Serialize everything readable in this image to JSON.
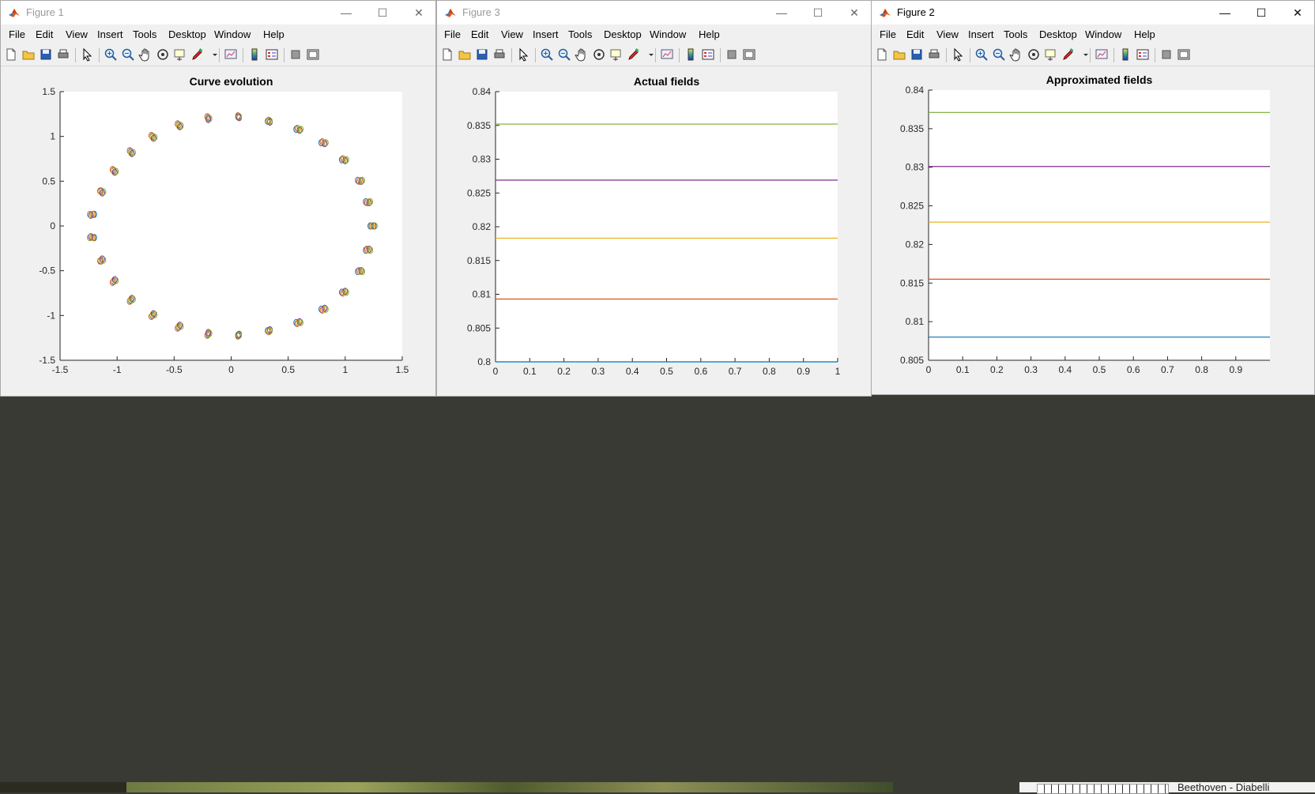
{
  "windows": [
    {
      "id": "fig1",
      "title": "Figure 1",
      "menus": [
        "File",
        "Edit",
        "View",
        "Insert",
        "Tools",
        "Desktop",
        "Window",
        "Help"
      ]
    },
    {
      "id": "fig3",
      "title": "Figure 3",
      "menus": [
        "File",
        "Edit",
        "View",
        "Insert",
        "Tools",
        "Desktop",
        "Window",
        "Help"
      ]
    },
    {
      "id": "fig2",
      "title": "Figure 2",
      "menus": [
        "File",
        "Edit",
        "View",
        "Insert",
        "Tools",
        "Desktop",
        "Window",
        "Help"
      ]
    }
  ],
  "window_buttons": {
    "minimize": "—",
    "maximize": "☐",
    "close": "✕"
  },
  "background": {
    "right_text": "Beethoven - Diabelli"
  },
  "colors": {
    "series": [
      "#0072bd",
      "#d95319",
      "#edb120",
      "#7e2f8e",
      "#77ac30"
    ]
  },
  "chart_data": [
    {
      "type": "scatter",
      "title": "Curve evolution",
      "xlim": [
        -1.5,
        1.5
      ],
      "ylim": [
        -1.5,
        1.5
      ],
      "xticks": [
        "-1.5",
        "-1",
        "-0.5",
        "0",
        "0.5",
        "1",
        "1.5"
      ],
      "yticks": [
        "-1.5",
        "-1",
        "-0.5",
        "0",
        "0.5",
        "1",
        "1.5"
      ],
      "marker": "circle",
      "series": [
        {
          "points": [
            [
              1.22,
              0
            ],
            [
              1.18,
              0.27
            ],
            [
              1.11,
              0.51
            ],
            [
              0.97,
              0.74
            ],
            [
              0.79,
              0.93
            ],
            [
              0.57,
              1.08
            ],
            [
              0.32,
              1.17
            ],
            [
              0.06,
              1.22
            ],
            [
              -0.2,
              1.21
            ],
            [
              -0.46,
              1.13
            ],
            [
              -0.69,
              1.0
            ],
            [
              -0.88,
              0.83
            ],
            [
              -1.03,
              0.62
            ],
            [
              -1.14,
              0.39
            ],
            [
              -1.2,
              0.13
            ],
            [
              -1.2,
              -0.13
            ],
            [
              -1.14,
              -0.39
            ],
            [
              -1.03,
              -0.62
            ],
            [
              -0.88,
              -0.83
            ],
            [
              -0.69,
              -1.0
            ],
            [
              -0.46,
              -1.13
            ],
            [
              -0.2,
              -1.21
            ],
            [
              0.06,
              -1.22
            ],
            [
              0.32,
              -1.17
            ],
            [
              0.57,
              -1.08
            ],
            [
              0.79,
              -0.93
            ],
            [
              0.97,
              -0.74
            ],
            [
              1.11,
              -0.51
            ],
            [
              1.18,
              -0.27
            ]
          ]
        },
        {
          "points": [
            [
              1.23,
              0
            ],
            [
              1.19,
              0.26
            ],
            [
              1.12,
              0.5
            ],
            [
              0.98,
              0.75
            ],
            [
              0.8,
              0.94
            ],
            [
              0.58,
              1.09
            ],
            [
              0.33,
              1.18
            ],
            [
              0.06,
              1.23
            ],
            [
              -0.21,
              1.22
            ],
            [
              -0.47,
              1.14
            ],
            [
              -0.7,
              1.01
            ],
            [
              -0.89,
              0.84
            ],
            [
              -1.04,
              0.63
            ],
            [
              -1.15,
              0.39
            ],
            [
              -1.21,
              0.13
            ],
            [
              -1.21,
              -0.13
            ],
            [
              -1.15,
              -0.39
            ],
            [
              -1.04,
              -0.63
            ],
            [
              -0.89,
              -0.84
            ],
            [
              -0.7,
              -1.01
            ],
            [
              -0.47,
              -1.14
            ],
            [
              -0.21,
              -1.22
            ],
            [
              0.06,
              -1.23
            ],
            [
              0.33,
              -1.18
            ],
            [
              0.58,
              -1.09
            ],
            [
              0.8,
              -0.94
            ],
            [
              0.98,
              -0.75
            ],
            [
              1.12,
              -0.5
            ],
            [
              1.19,
              -0.26
            ]
          ]
        },
        {
          "points": [
            [
              1.24,
              0
            ],
            [
              1.2,
              0.27
            ],
            [
              1.13,
              0.51
            ],
            [
              0.99,
              0.74
            ],
            [
              0.81,
              0.93
            ],
            [
              0.59,
              1.08
            ],
            [
              0.33,
              1.17
            ],
            [
              0.07,
              1.22
            ],
            [
              -0.2,
              1.2
            ],
            [
              -0.46,
              1.12
            ],
            [
              -0.69,
              0.99
            ],
            [
              -0.88,
              0.82
            ],
            [
              -1.03,
              0.61
            ],
            [
              -1.14,
              0.38
            ],
            [
              -1.22,
              0.13
            ],
            [
              -1.22,
              -0.13
            ],
            [
              -1.14,
              -0.38
            ],
            [
              -1.03,
              -0.61
            ],
            [
              -0.88,
              -0.82
            ],
            [
              -0.69,
              -0.99
            ],
            [
              -0.46,
              -1.12
            ],
            [
              -0.2,
              -1.2
            ],
            [
              0.07,
              -1.22
            ],
            [
              0.33,
              -1.17
            ],
            [
              0.59,
              -1.08
            ],
            [
              0.81,
              -0.93
            ],
            [
              0.99,
              -0.74
            ],
            [
              1.13,
              -0.51
            ],
            [
              1.2,
              -0.27
            ]
          ]
        },
        {
          "points": [
            [
              1.25,
              0
            ],
            [
              1.21,
              0.26
            ],
            [
              1.14,
              0.5
            ],
            [
              1.0,
              0.73
            ],
            [
              0.82,
              0.92
            ],
            [
              0.6,
              1.07
            ],
            [
              0.34,
              1.16
            ],
            [
              0.07,
              1.21
            ],
            [
              -0.2,
              1.19
            ],
            [
              -0.45,
              1.11
            ],
            [
              -0.68,
              0.98
            ],
            [
              -0.87,
              0.81
            ],
            [
              -1.02,
              0.6
            ],
            [
              -1.13,
              0.37
            ],
            [
              -1.23,
              0.12
            ],
            [
              -1.23,
              -0.12
            ],
            [
              -1.13,
              -0.37
            ],
            [
              -1.02,
              -0.6
            ],
            [
              -0.87,
              -0.81
            ],
            [
              -0.68,
              -0.98
            ],
            [
              -0.45,
              -1.11
            ],
            [
              -0.2,
              -1.19
            ],
            [
              0.07,
              -1.21
            ],
            [
              0.34,
              -1.16
            ],
            [
              0.6,
              -1.07
            ],
            [
              0.82,
              -0.92
            ],
            [
              1.0,
              -0.73
            ],
            [
              1.14,
              -0.5
            ],
            [
              1.21,
              -0.26
            ]
          ]
        },
        {
          "points": [
            [
              1.26,
              0
            ],
            [
              1.22,
              0.27
            ],
            [
              1.15,
              0.51
            ],
            [
              1.01,
              0.74
            ],
            [
              0.83,
              0.93
            ],
            [
              0.61,
              1.08
            ],
            [
              0.34,
              1.17
            ],
            [
              0.07,
              1.22
            ],
            [
              -0.19,
              1.2
            ],
            [
              -0.44,
              1.12
            ],
            [
              -0.67,
              0.99
            ],
            [
              -0.86,
              0.82
            ],
            [
              -1.01,
              0.61
            ],
            [
              -1.12,
              0.38
            ],
            [
              -1.24,
              0.13
            ],
            [
              -1.24,
              -0.13
            ],
            [
              -1.12,
              -0.38
            ],
            [
              -1.01,
              -0.61
            ],
            [
              -0.86,
              -0.82
            ],
            [
              -0.67,
              -0.99
            ],
            [
              -0.44,
              -1.12
            ],
            [
              -0.19,
              -1.2
            ],
            [
              0.07,
              -1.22
            ],
            [
              0.34,
              -1.17
            ],
            [
              0.61,
              -1.08
            ],
            [
              0.83,
              -0.93
            ],
            [
              1.01,
              -0.74
            ],
            [
              1.15,
              -0.51
            ],
            [
              1.22,
              -0.27
            ]
          ]
        }
      ]
    },
    {
      "type": "line",
      "title": "Actual fields",
      "xlim": [
        0,
        1
      ],
      "ylim": [
        0.8,
        0.84
      ],
      "xticks": [
        "0",
        "0.1",
        "0.2",
        "0.3",
        "0.4",
        "0.5",
        "0.6",
        "0.7",
        "0.8",
        "0.9",
        "1"
      ],
      "yticks": [
        "0.8",
        "0.805",
        "0.81",
        "0.815",
        "0.82",
        "0.825",
        "0.83",
        "0.835",
        "0.84"
      ],
      "series": [
        {
          "x": [
            0,
            1
          ],
          "y": [
            0.8,
            0.8
          ]
        },
        {
          "x": [
            0,
            1
          ],
          "y": [
            0.8093,
            0.8093
          ]
        },
        {
          "x": [
            0,
            1
          ],
          "y": [
            0.8183,
            0.8183
          ]
        },
        {
          "x": [
            0,
            1
          ],
          "y": [
            0.8269,
            0.8269
          ]
        },
        {
          "x": [
            0,
            1
          ],
          "y": [
            0.8352,
            0.8352
          ]
        }
      ]
    },
    {
      "type": "line",
      "title": "Approximated fields",
      "xlim": [
        0,
        1
      ],
      "ylim": [
        0.805,
        0.84
      ],
      "xticks": [
        "0",
        "0.1",
        "0.2",
        "0.3",
        "0.4",
        "0.5",
        "0.6",
        "0.7",
        "0.8",
        "0.9"
      ],
      "yticks": [
        "0.805",
        "0.81",
        "0.815",
        "0.82",
        "0.825",
        "0.83",
        "0.835",
        "0.84"
      ],
      "series": [
        {
          "x": [
            0,
            1
          ],
          "y": [
            0.808,
            0.808
          ]
        },
        {
          "x": [
            0,
            1
          ],
          "y": [
            0.8155,
            0.8155
          ]
        },
        {
          "x": [
            0,
            1
          ],
          "y": [
            0.8229,
            0.8229
          ]
        },
        {
          "x": [
            0,
            1
          ],
          "y": [
            0.8301,
            0.8301
          ]
        },
        {
          "x": [
            0,
            1
          ],
          "y": [
            0.8371,
            0.8371
          ]
        }
      ]
    }
  ]
}
